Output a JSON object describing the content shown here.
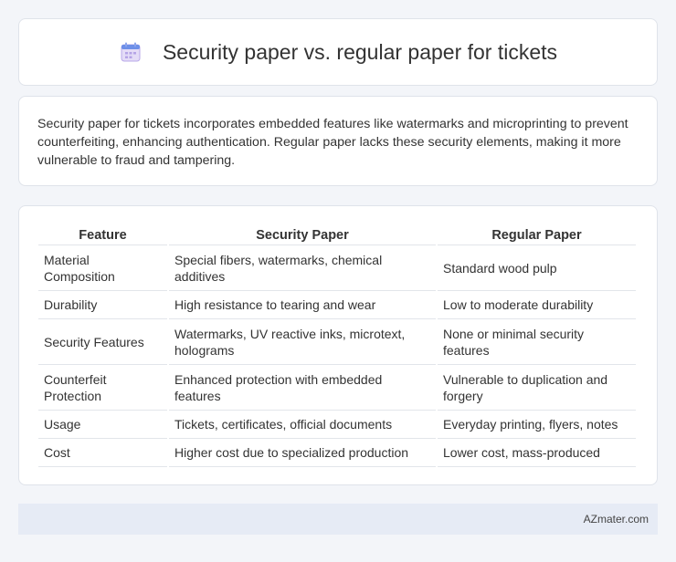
{
  "header": {
    "title": "Security paper vs. regular paper for tickets",
    "icon": "calendar-icon"
  },
  "summary": {
    "text": "Security paper for tickets incorporates embedded features like watermarks and microprinting to prevent counterfeiting, enhancing authentication. Regular paper lacks these security elements, making it more vulnerable to fraud and tampering."
  },
  "table": {
    "headers": [
      "Feature",
      "Security Paper",
      "Regular Paper"
    ],
    "rows": [
      [
        "Material Composition",
        "Special fibers, watermarks, chemical additives",
        "Standard wood pulp"
      ],
      [
        "Durability",
        "High resistance to tearing and wear",
        "Low to moderate durability"
      ],
      [
        "Security Features",
        "Watermarks, UV reactive inks, microtext, holograms",
        "None or minimal security features"
      ],
      [
        "Counterfeit Protection",
        "Enhanced protection with embedded features",
        "Vulnerable to duplication and forgery"
      ],
      [
        "Usage",
        "Tickets, certificates, official documents",
        "Everyday printing, flyers, notes"
      ],
      [
        "Cost",
        "Higher cost due to specialized production",
        "Lower cost, mass-produced"
      ]
    ]
  },
  "footer": {
    "text": "AZmater.com"
  }
}
